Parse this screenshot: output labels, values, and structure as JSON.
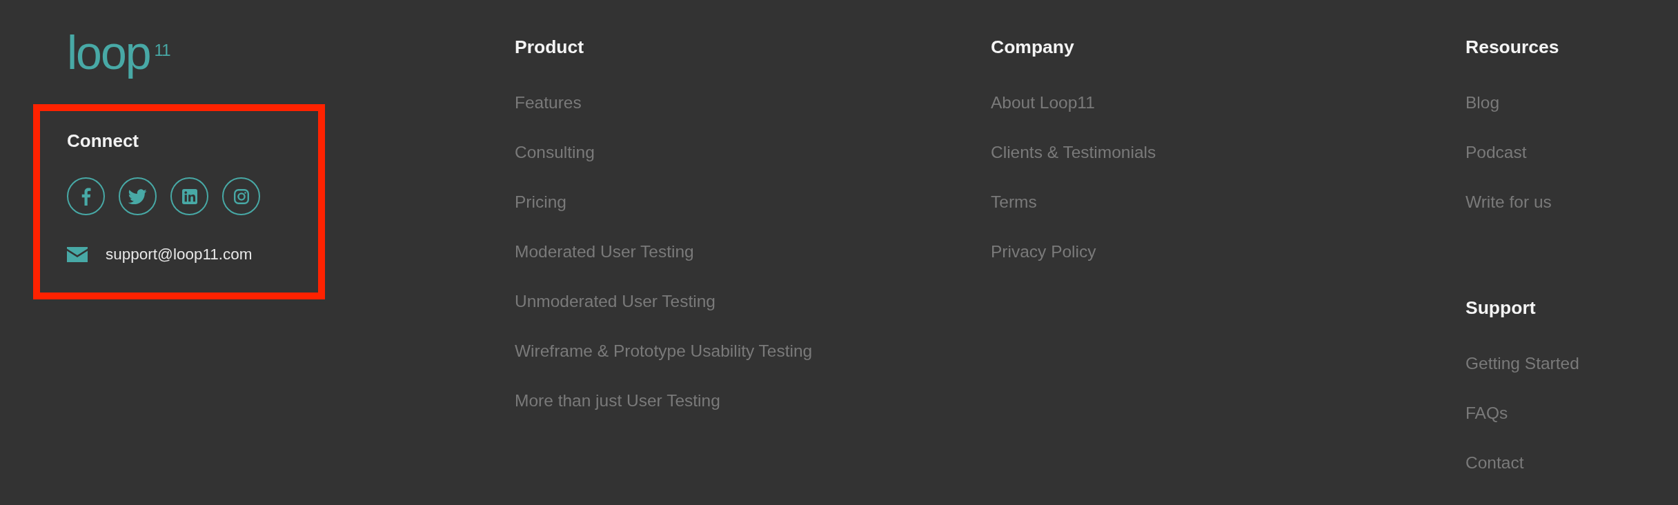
{
  "logo": "loop$^{11}$",
  "connect": {
    "heading": "Connect",
    "highlighted": true,
    "email": "support@loop11.com"
  },
  "columns": [
    {
      "sections": [
        {
          "heading": "Product",
          "links": [
            "Features",
            "Consulting",
            "Pricing",
            "Moderated User Testing",
            "Unmoderated User Testing",
            "Wireframe & Prototype Usability Testing",
            "More than just User Testing"
          ]
        }
      ]
    },
    {
      "sections": [
        {
          "heading": "Company",
          "links": [
            "About Loop11",
            "Clients & Testimonials",
            "Terms",
            "Privacy Policy"
          ]
        }
      ]
    },
    {
      "sections": [
        {
          "heading": "Resources",
          "links": [
            "Blog",
            "Podcast",
            "Write for us"
          ]
        },
        {
          "heading": "Support",
          "links": [
            "Getting Started",
            "FAQs",
            "Contact"
          ]
        }
      ]
    }
  ]
}
